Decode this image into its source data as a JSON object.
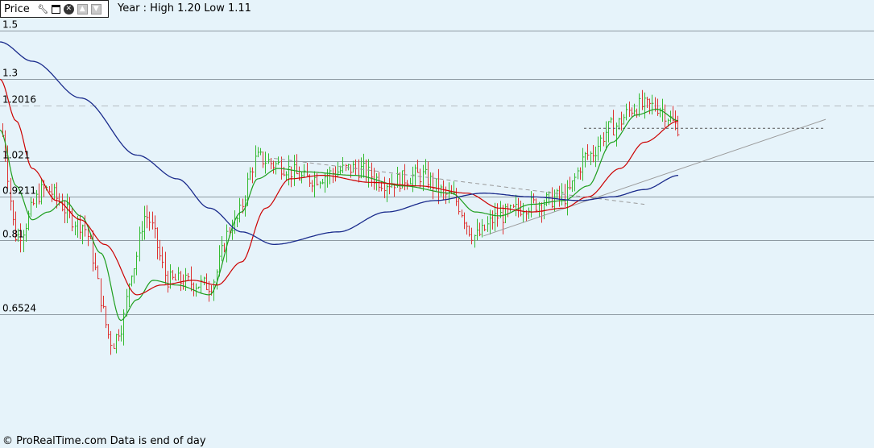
{
  "header": {
    "title": "Price",
    "info": "Year : High 1.20 Low 1.11",
    "icons": [
      "wrench-icon",
      "window-icon",
      "close-icon",
      "arrow-up-icon",
      "arrow-down-icon"
    ]
  },
  "footer": {
    "text": "© ProRealTime.com Data is end of day"
  },
  "colors": {
    "background": "#e6f3fa",
    "grid": "#8e9aa2",
    "up_bar": "#33bb33",
    "down_bar": "#dd3333",
    "ma_short": "#1e9e1e",
    "ma_mid": "#cc0000",
    "ma_long": "#1a2b8c",
    "trendline": "#999999"
  },
  "chart_data": {
    "type": "line",
    "ylim": [
      0.44,
      1.64
    ],
    "yscale": "log",
    "y_ticks": [
      {
        "label": "1.5",
        "value": 1.5,
        "style": "solid"
      },
      {
        "label": "1.3",
        "value": 1.3,
        "style": "solid"
      },
      {
        "label": "1.2016",
        "value": 1.2016,
        "style": "dashed"
      },
      {
        "label": "1.021",
        "value": 1.021,
        "style": "solid"
      },
      {
        "label": "0.9211",
        "value": 0.9211,
        "style": "solid"
      },
      {
        "label": "0.81",
        "value": 0.81,
        "style": "solid"
      },
      {
        "label": "0.6524",
        "value": 0.6524,
        "style": "solid"
      }
    ],
    "price_keypoints": [
      [
        0,
        1.12
      ],
      [
        20,
        0.82
      ],
      [
        55,
        0.94
      ],
      [
        100,
        0.85
      ],
      [
        140,
        0.6
      ],
      [
        150,
        0.63
      ],
      [
        165,
        0.75
      ],
      [
        180,
        0.87
      ],
      [
        210,
        0.72
      ],
      [
        260,
        0.71
      ],
      [
        290,
        0.85
      ],
      [
        320,
        1.03
      ],
      [
        345,
        1.01
      ],
      [
        380,
        0.97
      ],
      [
        440,
        1.0
      ],
      [
        480,
        0.96
      ],
      [
        520,
        0.98
      ],
      [
        560,
        0.92
      ],
      [
        590,
        0.82
      ],
      [
        620,
        0.87
      ],
      [
        660,
        0.9
      ],
      [
        700,
        0.92
      ],
      [
        730,
        1.04
      ],
      [
        760,
        1.13
      ],
      [
        790,
        1.2
      ],
      [
        815,
        1.2
      ],
      [
        843,
        1.13
      ]
    ],
    "series": [
      {
        "key": "ma_short",
        "points": [
          [
            0,
            1.12
          ],
          [
            20,
            0.95
          ],
          [
            40,
            0.86
          ],
          [
            60,
            0.88
          ],
          [
            80,
            0.91
          ],
          [
            100,
            0.87
          ],
          [
            125,
            0.78
          ],
          [
            150,
            0.64
          ],
          [
            170,
            0.68
          ],
          [
            190,
            0.72
          ],
          [
            220,
            0.71
          ],
          [
            260,
            0.69
          ],
          [
            300,
            0.88
          ],
          [
            320,
            0.97
          ],
          [
            345,
            1.0
          ],
          [
            380,
            0.99
          ],
          [
            440,
            0.98
          ],
          [
            500,
            0.95
          ],
          [
            560,
            0.93
          ],
          [
            590,
            0.88
          ],
          [
            620,
            0.87
          ],
          [
            660,
            0.9
          ],
          [
            700,
            0.91
          ],
          [
            730,
            0.95
          ],
          [
            760,
            1.08
          ],
          [
            790,
            1.17
          ],
          [
            815,
            1.19
          ],
          [
            843,
            1.15
          ]
        ]
      },
      {
        "key": "ma_mid",
        "points": [
          [
            0,
            1.3
          ],
          [
            20,
            1.15
          ],
          [
            40,
            1.0
          ],
          [
            70,
            0.91
          ],
          [
            100,
            0.86
          ],
          [
            130,
            0.8
          ],
          [
            170,
            0.69
          ],
          [
            200,
            0.71
          ],
          [
            240,
            0.72
          ],
          [
            270,
            0.71
          ],
          [
            300,
            0.76
          ],
          [
            330,
            0.89
          ],
          [
            360,
            0.97
          ],
          [
            400,
            0.98
          ],
          [
            460,
            0.96
          ],
          [
            520,
            0.95
          ],
          [
            580,
            0.93
          ],
          [
            620,
            0.89
          ],
          [
            660,
            0.88
          ],
          [
            700,
            0.89
          ],
          [
            730,
            0.92
          ],
          [
            770,
            1.0
          ],
          [
            800,
            1.08
          ],
          [
            843,
            1.15
          ]
        ]
      },
      {
        "key": "ma_long",
        "points": [
          [
            0,
            1.45
          ],
          [
            40,
            1.37
          ],
          [
            100,
            1.23
          ],
          [
            170,
            1.04
          ],
          [
            220,
            0.97
          ],
          [
            260,
            0.89
          ],
          [
            300,
            0.83
          ],
          [
            340,
            0.8
          ],
          [
            420,
            0.83
          ],
          [
            480,
            0.88
          ],
          [
            540,
            0.91
          ],
          [
            600,
            0.93
          ],
          [
            660,
            0.92
          ],
          [
            720,
            0.91
          ],
          [
            760,
            0.92
          ],
          [
            800,
            0.94
          ],
          [
            843,
            0.98
          ]
        ]
      }
    ],
    "trendlines": [
      {
        "style": "dashed",
        "points": [
          [
            340,
            1.03
          ],
          [
            800,
            0.9
          ]
        ]
      },
      {
        "style": "solid",
        "points": [
          [
            600,
            0.82
          ],
          [
            1025,
            1.155
          ]
        ]
      },
      {
        "style": "dotted",
        "points": [
          [
            725,
            1.125
          ],
          [
            1025,
            1.125
          ]
        ]
      }
    ]
  }
}
